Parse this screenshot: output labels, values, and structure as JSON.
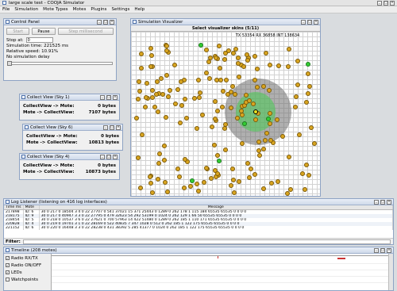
{
  "window": {
    "title": "large scale test - COOJA Simulator"
  },
  "menu": [
    "File",
    "Simulation",
    "Mote Types",
    "Motes",
    "Plugins",
    "Settings",
    "Help"
  ],
  "control": {
    "title": "Control Panel",
    "buttons": [
      "Start",
      "Pause",
      "Step millisecond"
    ],
    "stop_label": "Stop at:",
    "stop_value": "0",
    "sim_time": "Simulation time: 221525 ms",
    "speed": "Relative speed: 10.91%",
    "delay": "No simulation delay"
  },
  "collect": [
    {
      "title": "Collect View (Sky 1)",
      "r1_label": "CollectView -> Mote:",
      "r1_val": "0 bytes",
      "r2_label": "Mote -> CollectView:",
      "r2_val": "7107 bytes"
    },
    {
      "title": "Collect View (Sky 6)",
      "r1_label": "CollectView -> Mote:",
      "r1_val": "0 bytes",
      "r2_label": "Mote -> CollectView:",
      "r2_val": "10813 bytes"
    },
    {
      "title": "Collect View (Sky 4)",
      "r1_label": "CollectView -> Mote:",
      "r1_val": "0 bytes",
      "r2_label": "Mote -> CollectView:",
      "r2_val": "10873 bytes"
    }
  ],
  "visualizer": {
    "title": "Simulation Visualizer",
    "skins": "Select visualizer skins (5/11)",
    "tooltip": "TX 53354 RX 36858 INT 138634"
  },
  "log": {
    "title": "Log Listener (listening on 416 log interfaces)",
    "headers": [
      "Time ms",
      "Mote",
      "Message"
    ],
    "rows": [
      [
        "217898",
        "ID: 6",
        "30 0 217 0 18504 3 4 0 22 27707 0 541 37021 15 371 25443 0 1289 0 262 178 1 115 184 65535 65535 0 0 0 0"
      ],
      [
        "218175",
        "ID: 9",
        "30 0 217 0 40947 3 3 0 22 27795 0 479 32623 54 292 53199 0 1024 0 262 129 1 66 50 65535 65535 0 0 0 0"
      ],
      [
        "218454",
        "ID: 5",
        "30 0 218 0 10537 3 6 0 22 27621 0 700 57963 14 422 51480 0 1289 0 262 185 1 110 171 65535 65535 0 0 0 0"
      ],
      [
        "220828",
        "ID: 4",
        "30 0 219 0 19701 3 1 0 22 28169 0 522 40835 7 347 1028 0 512 0 262 185 1 122 175 65535 65535 0 0 0 0"
      ],
      [
        "221152",
        "ID: 6",
        "30 0 220 0 16448 3 3 0 22 28238 0 431 38392 5 285 41377 0 1024 0 262 185 1 122 175 65535 65535 0 0 0 0"
      ]
    ],
    "filter_label": "Filter:"
  },
  "timeline": {
    "title": "Timeline (208 motes)",
    "options": [
      {
        "label": "Radio RX/TX",
        "checked": true
      },
      {
        "label": "Radio ON/OFF",
        "checked": true
      },
      {
        "label": "LEDs",
        "checked": true
      },
      {
        "label": "Watchpoints",
        "checked": false
      }
    ]
  }
}
